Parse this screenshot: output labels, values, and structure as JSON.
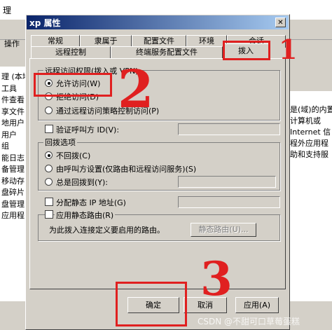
{
  "background": {
    "window_title_fragment": "理",
    "menu_fragment": "操作",
    "tree_items": [
      "理 (本地",
      "工具",
      "件查看",
      "享文件",
      "地用户",
      "用户",
      "组",
      "能日志",
      "备管理",
      "移动存",
      "盘碎片",
      "盘管理",
      "应用程"
    ],
    "right_texts": [
      "是(域)的内置",
      "计算机或",
      "Internet 信",
      "程外应用程",
      "助和支持服"
    ]
  },
  "dialog": {
    "title": "xp 属性",
    "close_glyph": "✕",
    "tabs_row1": [
      "常规",
      "隶属于",
      "配置文件",
      "环境",
      "会话"
    ],
    "tabs_row2": [
      "远程控制",
      "终端服务配置文件",
      "拨入"
    ],
    "access_group": {
      "legend": "远程访问权限(拨入或 VPN)",
      "options": [
        "允许访问(W)",
        "拒绝访问(D)",
        "通过远程访问策略控制访问(P)"
      ],
      "selected": 0
    },
    "verify_caller_id": "验证呼叫方 ID(V):",
    "callback_group": {
      "legend": "回拨选项",
      "options": [
        "不回拨(C)",
        "由呼叫方设置(仅路由和远程访问服务)(S)",
        "总是回拨到(Y):"
      ],
      "selected": 0
    },
    "assign_static_ip": "分配静态 IP 地址(G)",
    "apply_static_routes": "应用静态路由(R)",
    "routes_description": "为此拨入连接定义要启用的路由。",
    "static_routes_button": "静态路由(U)...",
    "ok_button": "确定",
    "cancel_button": "取消",
    "apply_button": "应用(A)"
  },
  "annotations": {
    "mark_1": "1",
    "mark_2": "2",
    "mark_3": "3",
    "watermark": "CSDN @不甜可口草莓蛋糕"
  },
  "colors": {
    "annotation_red": "#e02020",
    "title_bar": "#0a246a",
    "face": "#d4d0c8"
  }
}
